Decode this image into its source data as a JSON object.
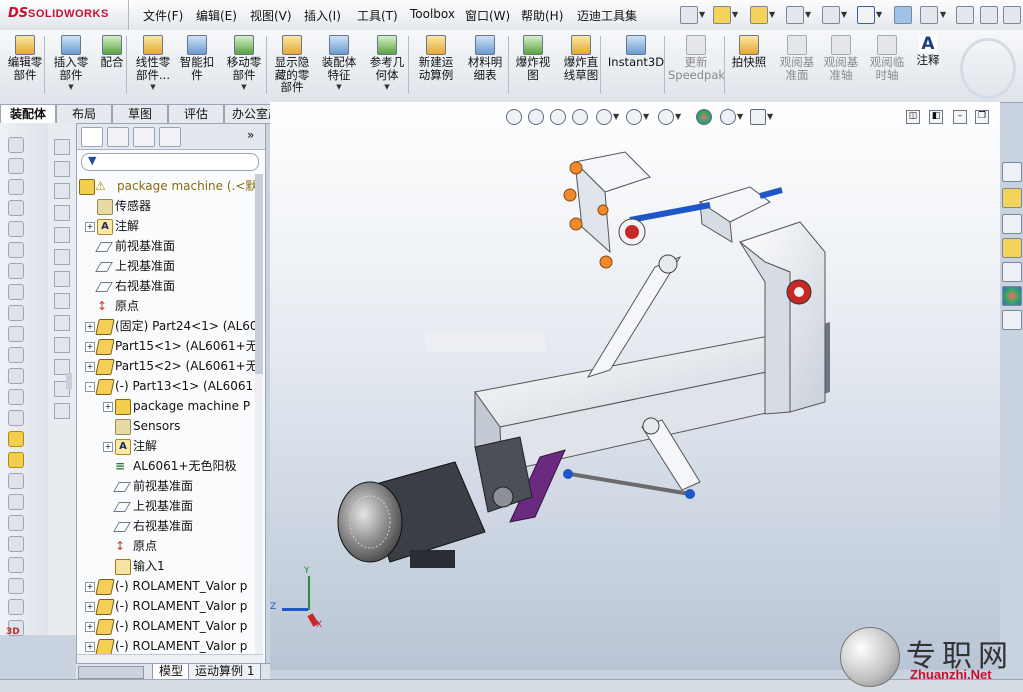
{
  "app": {
    "brand_ds": "DS",
    "brand_name": "SOLIDWORKS"
  },
  "menu": [
    "文件(F)",
    "编辑(E)",
    "视图(V)",
    "插入(I)",
    "工具(T)",
    "Toolbox",
    "窗口(W)",
    "帮助(H)",
    "迈迪工具集"
  ],
  "commands": [
    {
      "label1": "编辑零",
      "label2": "部件",
      "label3": "",
      "disabled": false,
      "icon": "edit-component-icon"
    },
    {
      "label1": "插入零",
      "label2": "部件",
      "label3": "▼",
      "disabled": false,
      "icon": "insert-component-icon"
    },
    {
      "label1": "配合",
      "label2": "",
      "label3": "",
      "disabled": false,
      "icon": "mate-icon"
    },
    {
      "label1": "线性零",
      "label2": "部件...",
      "label3": "▼",
      "disabled": false,
      "icon": "linear-pattern-icon"
    },
    {
      "label1": "智能扣",
      "label2": "件",
      "label3": "",
      "disabled": false,
      "icon": "smart-fasteners-icon"
    },
    {
      "label1": "移动零",
      "label2": "部件",
      "label3": "▼",
      "disabled": false,
      "icon": "move-component-icon"
    },
    {
      "label1": "显示隐",
      "label2": "藏的零",
      "label3": "部件",
      "disabled": false,
      "icon": "show-hidden-icon"
    },
    {
      "label1": "装配体",
      "label2": "特征",
      "label3": "▼",
      "disabled": false,
      "icon": "assembly-features-icon"
    },
    {
      "label1": "参考几",
      "label2": "何体",
      "label3": "▼",
      "disabled": false,
      "icon": "reference-geometry-icon"
    },
    {
      "label1": "新建运",
      "label2": "动算例",
      "label3": "",
      "disabled": false,
      "icon": "new-motion-study-icon"
    },
    {
      "label1": "材料明",
      "label2": "细表",
      "label3": "",
      "disabled": false,
      "icon": "bom-icon"
    },
    {
      "label1": "爆炸视",
      "label2": "图",
      "label3": "",
      "disabled": false,
      "icon": "exploded-view-icon"
    },
    {
      "label1": "爆炸直",
      "label2": "线草图",
      "label3": "",
      "disabled": false,
      "icon": "explode-line-sketch-icon"
    },
    {
      "label1": "Instant3D",
      "label2": "",
      "label3": "",
      "disabled": false,
      "icon": "instant3d-icon"
    },
    {
      "label1": "更新",
      "label2": "Speedpak",
      "label3": "",
      "disabled": true,
      "icon": "update-speedpak-icon"
    },
    {
      "label1": "拍快照",
      "label2": "",
      "label3": "",
      "disabled": false,
      "icon": "take-snapshot-icon"
    },
    {
      "label1": "观阅基",
      "label2": "准面",
      "label3": "",
      "disabled": true,
      "icon": "view-planes-icon"
    },
    {
      "label1": "观阅基",
      "label2": "准轴",
      "label3": "",
      "disabled": true,
      "icon": "view-axes-icon"
    },
    {
      "label1": "观阅临",
      "label2": "时轴",
      "label3": "",
      "disabled": true,
      "icon": "view-temp-axes-icon"
    },
    {
      "label1": "注释",
      "label2": "",
      "label3": "",
      "disabled": false,
      "icon": "annotation-icon",
      "glyph": "A"
    }
  ],
  "tabs": [
    "装配体",
    "布局",
    "草图",
    "评估",
    "办公室产品"
  ],
  "tree": [
    {
      "label": "package machine  (.<默",
      "indent": 0,
      "expand": "",
      "icon": "assembly",
      "color": "#8a6b12"
    },
    {
      "label": "传感器",
      "indent": 1,
      "expand": "",
      "icon": "sensor",
      "color": "#111"
    },
    {
      "label": "注解",
      "indent": 1,
      "expand": "+",
      "icon": "annotation",
      "color": "#111"
    },
    {
      "label": "前视基准面",
      "indent": 1,
      "expand": "",
      "icon": "plane",
      "color": "#111"
    },
    {
      "label": "上视基准面",
      "indent": 1,
      "expand": "",
      "icon": "plane",
      "color": "#111"
    },
    {
      "label": "右视基准面",
      "indent": 1,
      "expand": "",
      "icon": "plane",
      "color": "#111"
    },
    {
      "label": "原点",
      "indent": 1,
      "expand": "",
      "icon": "origin",
      "color": "#111"
    },
    {
      "label": "(固定) Part24<1> (AL60",
      "indent": 1,
      "expand": "+",
      "icon": "part",
      "color": "#111"
    },
    {
      "label": "Part15<1> (AL6061+无",
      "indent": 1,
      "expand": "+",
      "icon": "part",
      "color": "#111"
    },
    {
      "label": "Part15<2> (AL6061+无",
      "indent": 1,
      "expand": "+",
      "icon": "part",
      "color": "#111"
    },
    {
      "label": "(-) Part13<1> (AL6061",
      "indent": 1,
      "expand": "-",
      "icon": "part",
      "color": "#111"
    },
    {
      "label": "package machine P",
      "indent": 2,
      "expand": "+",
      "icon": "assembly",
      "color": "#111"
    },
    {
      "label": "Sensors",
      "indent": 2,
      "expand": "",
      "icon": "sensor",
      "color": "#111"
    },
    {
      "label": "注解",
      "indent": 2,
      "expand": "+",
      "icon": "annotation",
      "color": "#111"
    },
    {
      "label": "AL6061+无色阳极",
      "indent": 2,
      "expand": "",
      "icon": "material",
      "color": "#111"
    },
    {
      "label": "前视基准面",
      "indent": 2,
      "expand": "",
      "icon": "plane",
      "color": "#111"
    },
    {
      "label": "上视基准面",
      "indent": 2,
      "expand": "",
      "icon": "plane",
      "color": "#111"
    },
    {
      "label": "右视基准面",
      "indent": 2,
      "expand": "",
      "icon": "plane",
      "color": "#111"
    },
    {
      "label": "原点",
      "indent": 2,
      "expand": "",
      "icon": "origin",
      "color": "#111"
    },
    {
      "label": "输入1",
      "indent": 2,
      "expand": "",
      "icon": "import",
      "color": "#111"
    },
    {
      "label": "(-) ROLAMENT_Valor p",
      "indent": 1,
      "expand": "+",
      "icon": "part",
      "color": "#111"
    },
    {
      "label": "(-) ROLAMENT_Valor p",
      "indent": 1,
      "expand": "+",
      "icon": "part",
      "color": "#111"
    },
    {
      "label": "(-) ROLAMENT_Valor p",
      "indent": 1,
      "expand": "+",
      "icon": "part",
      "color": "#111"
    },
    {
      "label": "(-) ROLAMENT_Valor p",
      "indent": 1,
      "expand": "+",
      "icon": "part",
      "color": "#111"
    }
  ],
  "bottom_tabs": [
    "模型",
    "运动算例 1"
  ],
  "triad": {
    "x": "X",
    "y": "Y",
    "z": "Z"
  },
  "watermark": {
    "title": "专职网",
    "url": "Zhuanzhi.Net"
  },
  "colors": {
    "brand": "#c8102e",
    "accent": "#3b5ea8"
  }
}
